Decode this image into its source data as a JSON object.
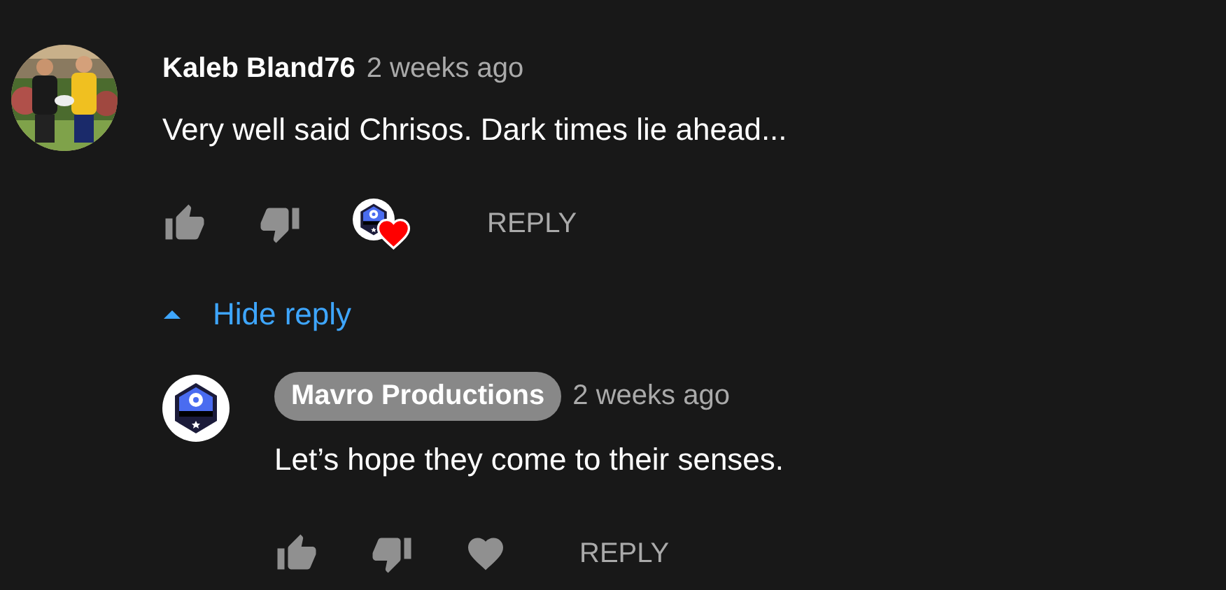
{
  "comment": {
    "author": "Kaleb Bland76",
    "owner": false,
    "time": "2 weeks ago",
    "text": "Very well said Chrisos. Dark times lie ahead...",
    "hearted": true,
    "reply_label": "REPLY"
  },
  "replies_toggle": {
    "label": "Hide reply",
    "expanded": true
  },
  "replies": [
    {
      "author": "Mavro Productions",
      "owner": true,
      "time": "2 weeks ago",
      "text": "Let’s hope they come to their senses.",
      "avatar": {
        "kind": "logo"
      },
      "hearted": false,
      "reply_label": "REPLY"
    }
  ]
}
